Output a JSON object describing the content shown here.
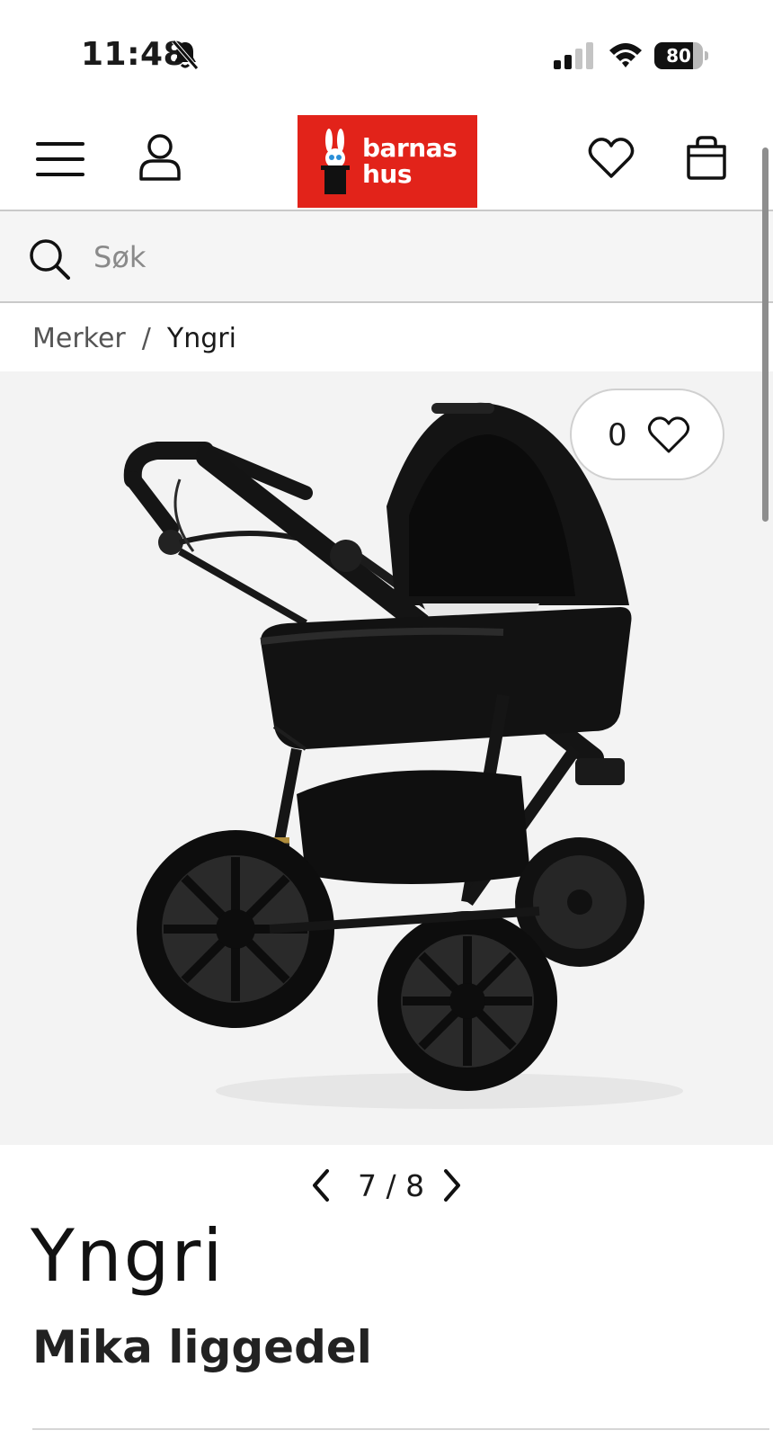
{
  "status_bar": {
    "time": "11:48",
    "battery_percent": "80",
    "battery_level": 0.8,
    "icons": [
      "bell-slash-icon",
      "cellular-signal-icon",
      "wifi-icon",
      "battery-icon"
    ]
  },
  "header": {
    "logo_line1": "barnas",
    "logo_line2": "hus",
    "brand_color": "#e2231a",
    "icons": [
      "menu-icon",
      "user-icon",
      "heart-icon",
      "shopping-bag-icon"
    ]
  },
  "search": {
    "placeholder": "Søk"
  },
  "breadcrumb": {
    "parent": "Merker",
    "separator": "/",
    "current": "Yngri"
  },
  "gallery": {
    "like_count": "0",
    "current": "7",
    "separator": "/",
    "total": "8"
  },
  "product": {
    "brand": "Yngri",
    "title": "Mika liggedel"
  }
}
